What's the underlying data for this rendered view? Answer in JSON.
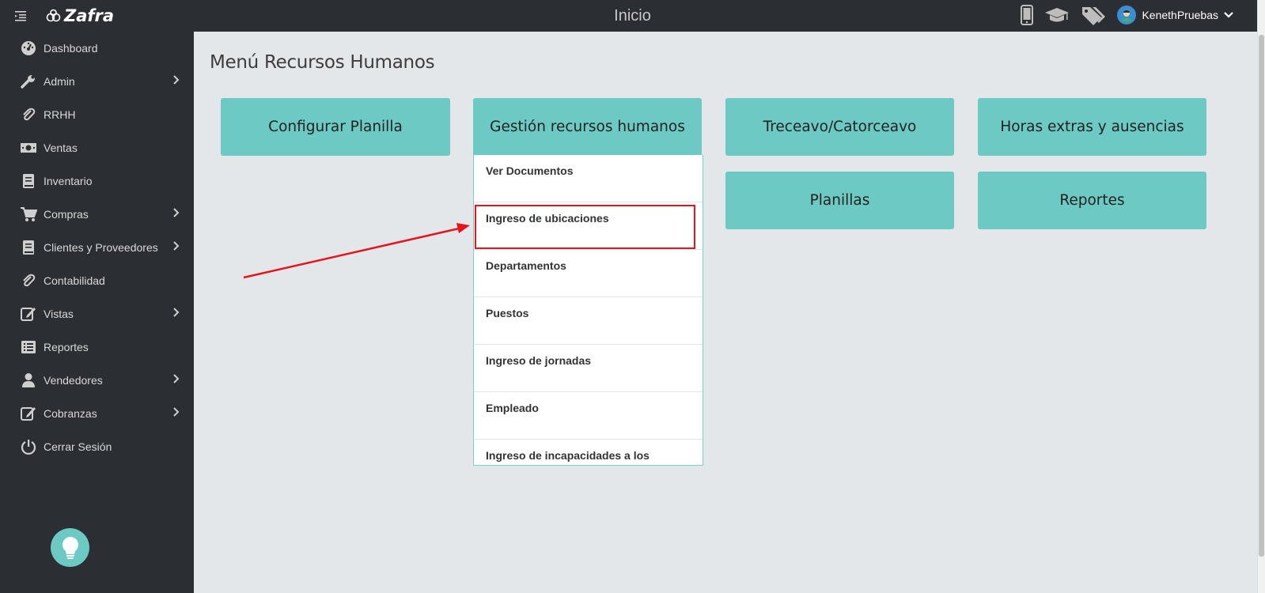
{
  "topbar": {
    "logo_text": "Zafra",
    "title": "Inicio",
    "user_name": "KenethPruebas",
    "icons": [
      "menu-collapse-icon",
      "mobile-icon",
      "graduation-cap-icon",
      "tags-icon",
      "user-avatar-icon",
      "chevron-down-icon"
    ]
  },
  "sidebar": {
    "items": [
      {
        "label": "Dashboard",
        "icon": "dashboard-icon",
        "has_submenu": false
      },
      {
        "label": "Admin",
        "icon": "wrench-icon",
        "has_submenu": true
      },
      {
        "label": "RRHH",
        "icon": "paperclip-icon",
        "has_submenu": false
      },
      {
        "label": "Ventas",
        "icon": "money-icon",
        "has_submenu": false
      },
      {
        "label": "Inventario",
        "icon": "book-icon",
        "has_submenu": false
      },
      {
        "label": "Compras",
        "icon": "cart-icon",
        "has_submenu": true
      },
      {
        "label": "Clientes y Proveedores",
        "icon": "book-icon",
        "has_submenu": true
      },
      {
        "label": "Contabilidad",
        "icon": "paperclip-icon",
        "has_submenu": false
      },
      {
        "label": "Vistas",
        "icon": "edit-icon",
        "has_submenu": true
      },
      {
        "label": "Reportes",
        "icon": "list-icon",
        "has_submenu": false
      },
      {
        "label": "Vendedores",
        "icon": "user-icon",
        "has_submenu": true
      },
      {
        "label": "Cobranzas",
        "icon": "edit-icon",
        "has_submenu": true
      },
      {
        "label": "Cerrar Sesión",
        "icon": "power-icon",
        "has_submenu": false
      }
    ],
    "help_icon": "lightbulb-icon"
  },
  "main": {
    "title": "Menú Recursos Humanos",
    "cards": {
      "configurar_planilla": "Configurar Planilla",
      "gestion_rrhh": "Gestión recursos humanos",
      "treceavo": "Treceavo/Catorceavo",
      "horas_extras": "Horas extras y ausencias",
      "planillas": "Planillas",
      "reportes": "Reportes"
    },
    "dropdown_items": [
      "Ver Documentos",
      "Ingreso de ubicaciones",
      "Departamentos",
      "Puestos",
      "Ingreso de jornadas",
      "Empleado",
      "Ingreso de incapacidades a los"
    ],
    "highlighted_item": "Ingreso de ubicaciones"
  },
  "colors": {
    "sidebar_bg": "#2b2e32",
    "content_bg": "#e3e7ea",
    "card_teal": "#6cc9c3",
    "annotation_red": "#e8141c"
  }
}
